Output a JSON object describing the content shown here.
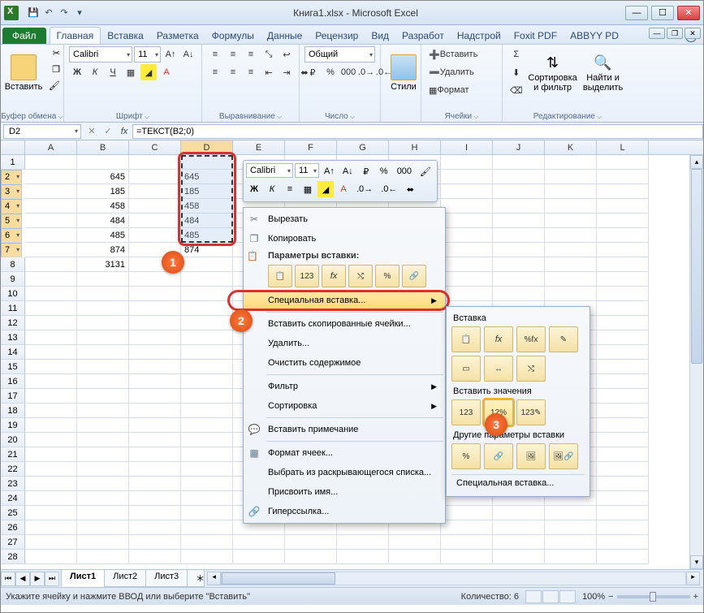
{
  "titlebar": {
    "title": "Книга1.xlsx - Microsoft Excel"
  },
  "tabs": {
    "file": "Файл",
    "items": [
      "Главная",
      "Вставка",
      "Разметка",
      "Формулы",
      "Данные",
      "Рецензир",
      "Вид",
      "Разработ",
      "Надстрой",
      "Foxit PDF",
      "ABBYY PD"
    ],
    "active": 0
  },
  "ribbon": {
    "clipboard": {
      "label": "Буфер обмена",
      "paste": "Вставить"
    },
    "font": {
      "label": "Шрифт",
      "name": "Calibri",
      "size": "11"
    },
    "alignment": {
      "label": "Выравнивание"
    },
    "number": {
      "label": "Число",
      "format": "Общий"
    },
    "styles": {
      "label": "Стили",
      "btn": "Стили"
    },
    "cells": {
      "label": "Ячейки",
      "insert": "Вставить",
      "delete": "Удалить",
      "format": "Формат"
    },
    "editing": {
      "label": "Редактирование",
      "sort": "Сортировка и фильтр",
      "find": "Найти и выделить"
    }
  },
  "namebox": "D2",
  "formula": "=ТЕКСТ(B2;0)",
  "columns": [
    "A",
    "B",
    "C",
    "D",
    "E",
    "F",
    "G",
    "H",
    "I",
    "J",
    "K",
    "L"
  ],
  "rowNumbers": [
    "1",
    "2",
    "3",
    "4",
    "5",
    "6",
    "7",
    "8",
    "9",
    "10",
    "11",
    "12",
    "13",
    "14",
    "15",
    "16",
    "17",
    "18",
    "19",
    "20",
    "21",
    "22",
    "23",
    "24",
    "25",
    "26",
    "27",
    "28"
  ],
  "colB": [
    "645",
    "185",
    "458",
    "484",
    "485",
    "874",
    "3131"
  ],
  "colD": [
    "645",
    "185",
    "458",
    "484",
    "485",
    "874"
  ],
  "miniToolbar": {
    "font": "Calibri",
    "size": "11"
  },
  "context": {
    "cut": "Вырезать",
    "copy": "Копировать",
    "pasteOptionsHeader": "Параметры вставки:",
    "pasteSpecial": "Специальная вставка...",
    "insertCopied": "Вставить скопированные ячейки...",
    "delete": "Удалить...",
    "clear": "Очистить содержимое",
    "filter": "Фильтр",
    "sort": "Сортировка",
    "insertComment": "Вставить примечание",
    "formatCells": "Формат ячеек...",
    "pickFromList": "Выбрать из раскрывающегося списка...",
    "defineName": "Присвоить имя...",
    "hyperlink": "Гиперссылка..."
  },
  "submenu": {
    "paste": "Вставка",
    "pasteValues": "Вставить значения",
    "otherOptions": "Другие параметры вставки",
    "special": "Специальная вставка..."
  },
  "sheets": [
    "Лист1",
    "Лист2",
    "Лист3"
  ],
  "status": {
    "left": "Укажите ячейку и нажмите ВВОД или выберите \"Вставить\"",
    "count_label": "Количество:",
    "count": "6",
    "zoom": "100%"
  },
  "badges": {
    "b1": "1",
    "b2": "2",
    "b3": "3"
  }
}
